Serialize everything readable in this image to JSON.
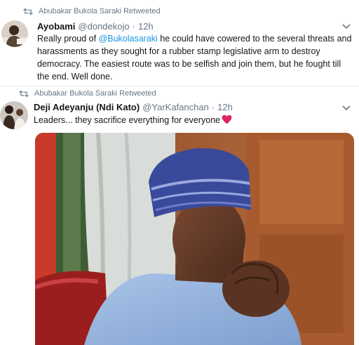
{
  "tweets": [
    {
      "retweeted_by": "Abubakar Bukola Saraki Retweeted",
      "name": "Ayobami",
      "handle": "@dondekojo",
      "dot": "·",
      "time": "12h",
      "text_before": "Really proud of ",
      "mention": "@Bukolasaraki",
      "text_after": " he could have cowered to the several threats and harassments as they sought for a rubber stamp legislative arm to destroy democracy. The easiest route was to be selfish and join them, but he fought till the end. Well done."
    },
    {
      "retweeted_by": "Abubakar Bukola Saraki Retweeted",
      "name": "Deji Adeyanju (Ndi Kato)",
      "handle": "@YarKafanchan",
      "dot": "·",
      "time": "12h",
      "text": "Leaders... they sacrifice everything for everyone"
    }
  ],
  "icons": {
    "retweet": "retweet-icon",
    "caret": "chevron-down-icon",
    "heart": "red-heart-emoji"
  },
  "colors": {
    "text": "#14171a",
    "secondary": "#657786",
    "link": "#1b95e0",
    "heart": "#e0245e"
  }
}
